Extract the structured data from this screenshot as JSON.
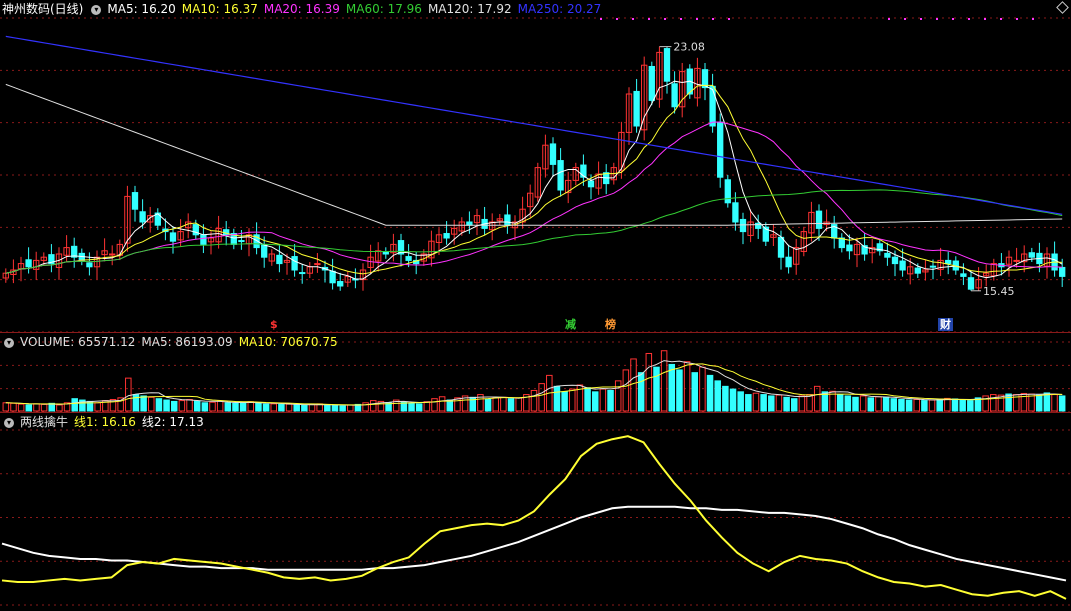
{
  "window": {
    "stock_title": "神州数码(日线)"
  },
  "price_panel": {
    "ma_legend": [
      {
        "label": "MA5: 16.20",
        "color": "#ffffff"
      },
      {
        "label": "MA10: 16.37",
        "color": "#ffff33"
      },
      {
        "label": "MA20: 16.39",
        "color": "#ff33ff"
      },
      {
        "label": "MA60: 17.96",
        "color": "#33cc33"
      },
      {
        "label": "MA120: 17.92",
        "color": "#e0e0e0"
      },
      {
        "label": "MA250: 20.27",
        "color": "#3333ff"
      }
    ],
    "high_label": "23.08",
    "low_label": "15.45",
    "markers": [
      {
        "text": "$",
        "color": "#ff3333"
      },
      {
        "text": "减",
        "color": "#33cc33"
      },
      {
        "text": "榜",
        "color": "#ff9933"
      },
      {
        "text": "财",
        "color": "#ffffff"
      }
    ]
  },
  "volume_panel": {
    "legend": [
      {
        "label": "VOLUME: 65571.12",
        "color": "#e0e0e0"
      },
      {
        "label": "MA5: 86193.09",
        "color": "#e0e0e0"
      },
      {
        "label": "MA10: 70670.75",
        "color": "#ffff33"
      }
    ]
  },
  "indicator_panel": {
    "title": "两线擒牛",
    "legend": [
      {
        "label": "线1: 16.16",
        "color": "#ffff33"
      },
      {
        "label": "线2: 17.13",
        "color": "#ffffff"
      }
    ]
  },
  "colors": {
    "up": "#ff3333",
    "down": "#33ffff",
    "grid": "#8a1a1a",
    "bg": "#000000"
  },
  "chart_data": [
    {
      "type": "candlestick",
      "series_close": [
        16.0,
        16.1,
        16.3,
        16.2,
        16.4,
        16.5,
        16.3,
        16.6,
        16.8,
        16.5,
        16.4,
        16.2,
        16.5,
        16.7,
        16.6,
        16.9,
        18.4,
        18.0,
        17.6,
        17.8,
        17.5,
        17.3,
        17.0,
        17.3,
        17.6,
        17.2,
        16.9,
        17.1,
        17.4,
        17.2,
        16.9,
        17.0,
        17.2,
        16.8,
        16.5,
        16.6,
        16.3,
        16.4,
        16.1,
        16.0,
        16.2,
        16.3,
        16.1,
        15.7,
        15.6,
        15.9,
        15.8,
        16.1,
        16.5,
        16.7,
        16.6,
        16.9,
        16.6,
        16.4,
        16.3,
        16.6,
        17.0,
        17.2,
        17.1,
        17.4,
        17.6,
        17.5,
        17.8,
        17.4,
        17.6,
        17.7,
        17.5,
        17.6,
        18.0,
        18.5,
        19.3,
        20.0,
        19.4,
        18.6,
        18.9,
        19.3,
        19.0,
        18.7,
        19.1,
        18.8,
        19.3,
        20.4,
        21.6,
        20.6,
        22.5,
        21.4,
        22.9,
        22.0,
        21.2,
        22.3,
        21.6,
        22.4,
        21.8,
        20.6,
        19.0,
        18.2,
        17.6,
        17.3,
        17.6,
        17.4,
        17.0,
        17.2,
        16.5,
        16.2,
        16.8,
        17.3,
        17.9,
        17.4,
        17.6,
        17.1,
        16.8,
        16.7,
        16.9,
        16.6,
        16.8,
        16.7,
        16.5,
        16.3,
        16.1,
        16.2,
        16.0,
        16.1,
        16.2,
        16.4,
        16.3,
        16.1,
        15.9,
        15.5,
        15.8,
        16.0,
        16.3,
        16.2,
        16.5,
        16.4,
        16.6,
        16.5,
        16.3,
        16.6,
        16.1,
        15.9
      ],
      "high": 23.08,
      "low": 15.45,
      "ma_lines": [
        "MA5",
        "MA10",
        "MA20",
        "MA60",
        "MA120",
        "MA250"
      ]
    },
    {
      "type": "bar",
      "name": "VOLUME",
      "values": [
        30,
        28,
        25,
        22,
        26,
        24,
        28,
        22,
        30,
        45,
        40,
        35,
        30,
        38,
        42,
        48,
        120,
        60,
        55,
        50,
        45,
        40,
        35,
        38,
        42,
        36,
        30,
        32,
        36,
        30,
        28,
        30,
        34,
        28,
        25,
        26,
        24,
        25,
        22,
        20,
        24,
        26,
        22,
        20,
        18,
        22,
        24,
        30,
        38,
        35,
        30,
        40,
        32,
        28,
        26,
        34,
        45,
        52,
        40,
        48,
        55,
        50,
        60,
        42,
        48,
        50,
        45,
        48,
        60,
        75,
        100,
        130,
        90,
        70,
        80,
        95,
        85,
        70,
        80,
        75,
        110,
        150,
        190,
        140,
        210,
        160,
        220,
        170,
        150,
        180,
        140,
        160,
        130,
        110,
        90,
        80,
        70,
        60,
        65,
        60,
        55,
        58,
        50,
        45,
        55,
        60,
        90,
        70,
        72,
        60,
        55,
        50,
        55,
        48,
        52,
        50,
        45,
        42,
        40,
        42,
        38,
        40,
        42,
        46,
        44,
        40,
        38,
        48,
        55,
        60,
        58,
        62,
        60,
        64,
        62,
        58,
        66,
        60,
        55
      ]
    },
    {
      "type": "line",
      "name": "两线擒牛",
      "series": [
        {
          "name": "线1",
          "values": [
            15.4,
            15.3,
            15.3,
            15.4,
            15.5,
            15.4,
            15.5,
            15.6,
            16.4,
            16.6,
            16.5,
            16.8,
            16.7,
            16.6,
            16.5,
            16.3,
            16.1,
            15.9,
            15.6,
            15.5,
            15.6,
            15.4,
            15.5,
            15.7,
            16.2,
            16.6,
            16.9,
            17.8,
            18.6,
            18.8,
            19.0,
            19.1,
            19.0,
            19.3,
            19.9,
            21.0,
            22.0,
            23.5,
            24.3,
            24.6,
            24.8,
            24.4,
            23.0,
            21.7,
            20.6,
            19.3,
            18.2,
            17.2,
            16.5,
            16.0,
            16.6,
            17.0,
            16.8,
            16.7,
            16.5,
            16.0,
            15.6,
            15.3,
            15.2,
            15.0,
            15.1,
            14.8,
            14.5,
            14.4,
            14.6,
            14.7,
            14.4,
            14.7,
            14.2
          ]
        },
        {
          "name": "线2",
          "values": [
            17.8,
            17.5,
            17.2,
            17.0,
            16.9,
            16.8,
            16.8,
            16.7,
            16.7,
            16.6,
            16.5,
            16.4,
            16.3,
            16.3,
            16.2,
            16.2,
            16.2,
            16.1,
            16.1,
            16.1,
            16.1,
            16.1,
            16.1,
            16.1,
            16.2,
            16.2,
            16.3,
            16.4,
            16.6,
            16.8,
            17.0,
            17.3,
            17.6,
            17.9,
            18.3,
            18.7,
            19.1,
            19.5,
            19.8,
            20.1,
            20.2,
            20.2,
            20.2,
            20.2,
            20.1,
            20.1,
            20.0,
            20.0,
            19.9,
            19.8,
            19.8,
            19.7,
            19.6,
            19.4,
            19.1,
            18.8,
            18.4,
            18.1,
            17.7,
            17.4,
            17.1,
            16.8,
            16.6,
            16.4,
            16.2,
            16.0,
            15.8,
            15.6,
            15.4
          ]
        }
      ]
    }
  ]
}
